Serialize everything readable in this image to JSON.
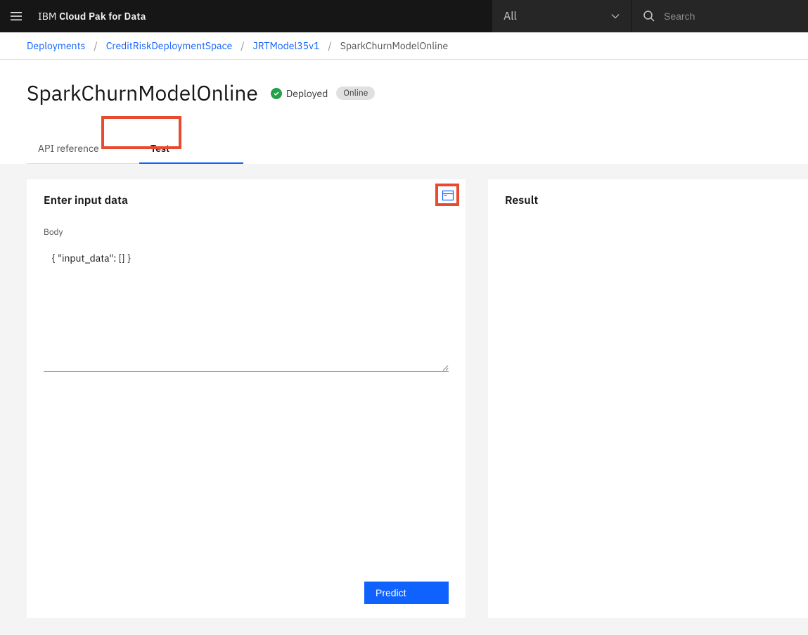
{
  "header": {
    "brand_light": "IBM ",
    "brand_bold": "Cloud Pak for Data",
    "filter_label": "All",
    "search_placeholder": "Search"
  },
  "breadcrumb": {
    "items": [
      {
        "label": "Deployments",
        "link": true
      },
      {
        "label": "CreditRiskDeploymentSpace",
        "link": true
      },
      {
        "label": "JRTModel35v1",
        "link": true
      },
      {
        "label": "SparkChurnModelOnline",
        "link": false
      }
    ],
    "separator": "/"
  },
  "title": {
    "text": "SparkChurnModelOnline",
    "status_text": "Deployed",
    "badge": "Online"
  },
  "tabs": {
    "inactive": "API reference",
    "active": "Test"
  },
  "left_panel": {
    "title": "Enter input data",
    "body_label": "Body",
    "body_value": "{ \"input_data\": [] }",
    "predict_label": "Predict"
  },
  "right_panel": {
    "title": "Result"
  }
}
